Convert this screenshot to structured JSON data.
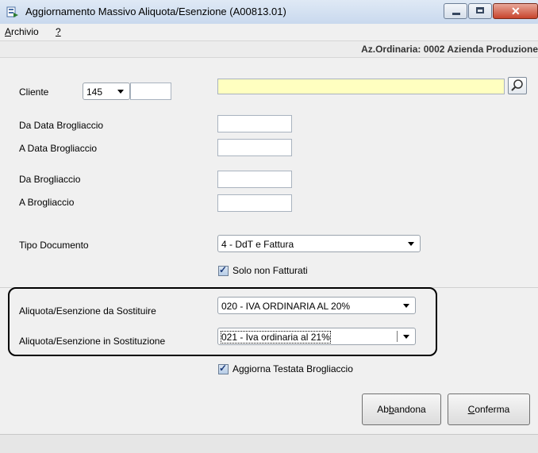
{
  "window": {
    "title": "Aggiornamento Massivo Aliquota/Esenzione (A00813.01)",
    "close_glyph": "✕"
  },
  "menu": {
    "archivio_prefix": "A",
    "archivio_rest": "rchivio",
    "help": "?"
  },
  "azienda": "Az.Ordinaria: 0002 Azienda Produzione",
  "cliente": {
    "label": "Cliente",
    "combo_value": "145",
    "code_value": "",
    "name_value": "",
    "name_bg": "#ffffc0"
  },
  "da_data_brogliaccio": {
    "label": "Da Data Brogliaccio",
    "value": ""
  },
  "a_data_brogliaccio": {
    "label": "A  Data Brogliaccio",
    "value": ""
  },
  "da_brogliaccio": {
    "label": "Da Brogliaccio",
    "value": ""
  },
  "a_brogliaccio": {
    "label": "A  Brogliaccio",
    "value": ""
  },
  "tipo_documento": {
    "label": "Tipo Documento",
    "value": "4 - DdT e Fattura"
  },
  "solo_non_fatturati": {
    "label": "Solo non Fatturati",
    "checked": true
  },
  "aliquota_da": {
    "label": "Aliquota/Esenzione da Sostituire",
    "value": "020 - IVA ORDINARIA AL 20%"
  },
  "aliquota_in": {
    "label": "Aliquota/Esenzione in Sostituzione",
    "value": "021 - Iva ordinaria al 21%"
  },
  "aggiorna_testata": {
    "label": "Aggiorna Testata Brogliaccio",
    "checked": true
  },
  "buttons": {
    "abbandona_pre": "Ab",
    "abbandona_u": "b",
    "abbandona_post": "andona",
    "conferma_u": "C",
    "conferma_post": "onferma"
  },
  "check_glyph": "✓"
}
